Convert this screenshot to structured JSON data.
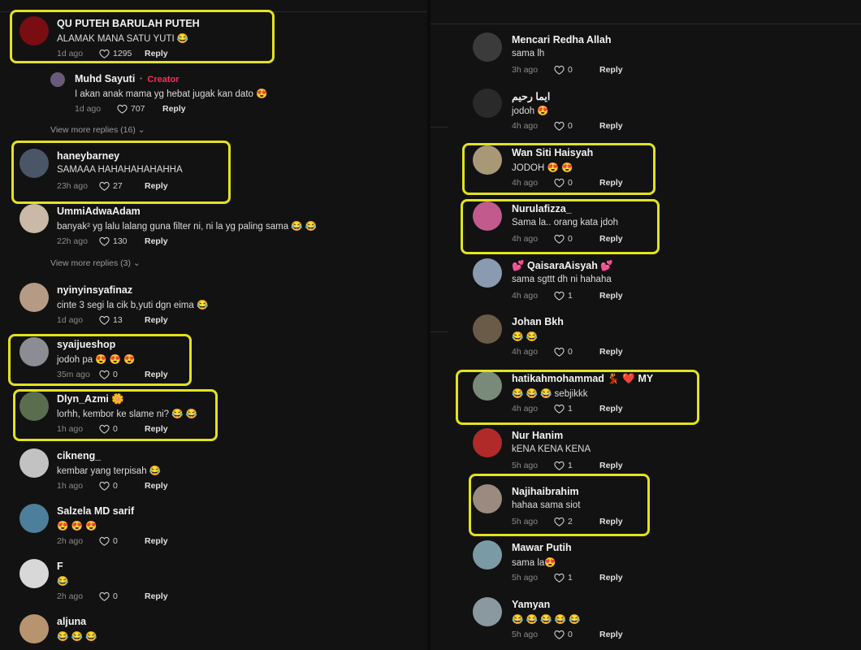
{
  "reply_label": "Reply",
  "left_column": {
    "comments": [
      {
        "username": "QU PUTEH BARULAH PUTEH",
        "text": "ALAMAK MANA SATU YUTI 😂",
        "time": "1d ago",
        "likes": "1295",
        "avatar_color": "#7a0d12"
      },
      {
        "username": "Muhd Sayuti",
        "badge": "Creator",
        "text": "I akan anak mama yg hebat jugak kan dato 😍",
        "time": "1d ago",
        "likes": "707",
        "avatar_color": "#6a5a7a"
      },
      {
        "username": "haneybarney",
        "text": "SAMAAA HAHAHAHAHAHHA",
        "time": "23h ago",
        "likes": "27",
        "avatar_color": "#4a5568"
      },
      {
        "username": "UmmiAdwaAdam",
        "text": "banyak² yg lalu lalang guna filter ni, ni la yg paling sama 😂 😂",
        "time": "22h ago",
        "likes": "130",
        "avatar_color": "#c9b9a6"
      },
      {
        "username": "nyinyinsyafinaz",
        "text": "cinte 3 segi la cik b,yuti dgn eima 😂",
        "time": "1d ago",
        "likes": "13",
        "avatar_color": "#b59a86"
      },
      {
        "username": "syaijueshop",
        "text": "jodoh pa 😍 😍 😍",
        "time": "35m ago",
        "likes": "0",
        "avatar_color": "#8c8c95"
      },
      {
        "username": "Dlyn_Azmi 🌼",
        "text": "lorhh, kembor ke slame ni? 😂 😂",
        "time": "1h ago",
        "likes": "0",
        "avatar_color": "#5b6d4f"
      },
      {
        "username": "cikneng_",
        "text": "kembar yang terpisah 😂",
        "time": "1h ago",
        "likes": "0",
        "avatar_color": "#c2c2c2"
      },
      {
        "username": "Salzela MD sarif",
        "text": "😍 😍 😍",
        "time": "2h ago",
        "likes": "0",
        "avatar_color": "#4e7f9a"
      },
      {
        "username": "F",
        "text": "😂",
        "time": "2h ago",
        "likes": "0",
        "avatar_color": "#d8d8d8"
      },
      {
        "username": "aljuna",
        "text": "😂 😂 😂",
        "time": "",
        "likes": "",
        "avatar_color": "#b89370"
      }
    ],
    "view_more": [
      "View more replies (16)",
      "View more replies (3)"
    ]
  },
  "right_column": {
    "comments": [
      {
        "username": "Mencari Redha Allah",
        "text": "sama lh",
        "time": "3h ago",
        "likes": "0",
        "avatar_color": "#3b3b3b"
      },
      {
        "username": "ايما رحيم",
        "text": "jodoh 😍",
        "time": "4h ago",
        "likes": "0",
        "avatar_color": "#2a2a2a"
      },
      {
        "username": "Wan Siti Haisyah",
        "text": "JODOH 😍 😍",
        "time": "4h ago",
        "likes": "0",
        "avatar_color": "#a89878"
      },
      {
        "username": "Nurulafizza_",
        "text": "Sama la.. orang kata jdoh",
        "time": "4h ago",
        "likes": "0",
        "avatar_color": "#c25a8e"
      },
      {
        "username": "💕 QaisaraAisyah 💕",
        "text": "sama sgttt dh ni hahaha",
        "time": "4h ago",
        "likes": "1",
        "avatar_color": "#8a9ab0"
      },
      {
        "username": "Johan Bkh",
        "text": "😂 😂",
        "time": "4h ago",
        "likes": "0",
        "avatar_color": "#6a5a48"
      },
      {
        "username": "hatikahmohammad 💃 ❤️ MY",
        "text": "😂 😂 😂 sebjikkk",
        "time": "4h ago",
        "likes": "1",
        "avatar_color": "#7a8a7a"
      },
      {
        "username": "Nur Hanim",
        "text": "kENA KENA KENA",
        "time": "5h ago",
        "likes": "1",
        "avatar_color": "#b02a2a"
      },
      {
        "username": "Najihaibrahim",
        "text": "hahaa sama siot",
        "time": "5h ago",
        "likes": "2",
        "avatar_color": "#9a8a80"
      },
      {
        "username": "Mawar Putih",
        "text": "sama la😍",
        "time": "5h ago",
        "likes": "1",
        "avatar_color": "#7a9aa6"
      },
      {
        "username": "Yamyan",
        "text": "😂 😂 😂 😂 😂",
        "time": "5h ago",
        "likes": "0",
        "avatar_color": "#8a98a0"
      }
    ]
  },
  "colors": {
    "highlight": "#e2e21e",
    "creator_badge": "#fe2c55",
    "background": "#121212"
  }
}
